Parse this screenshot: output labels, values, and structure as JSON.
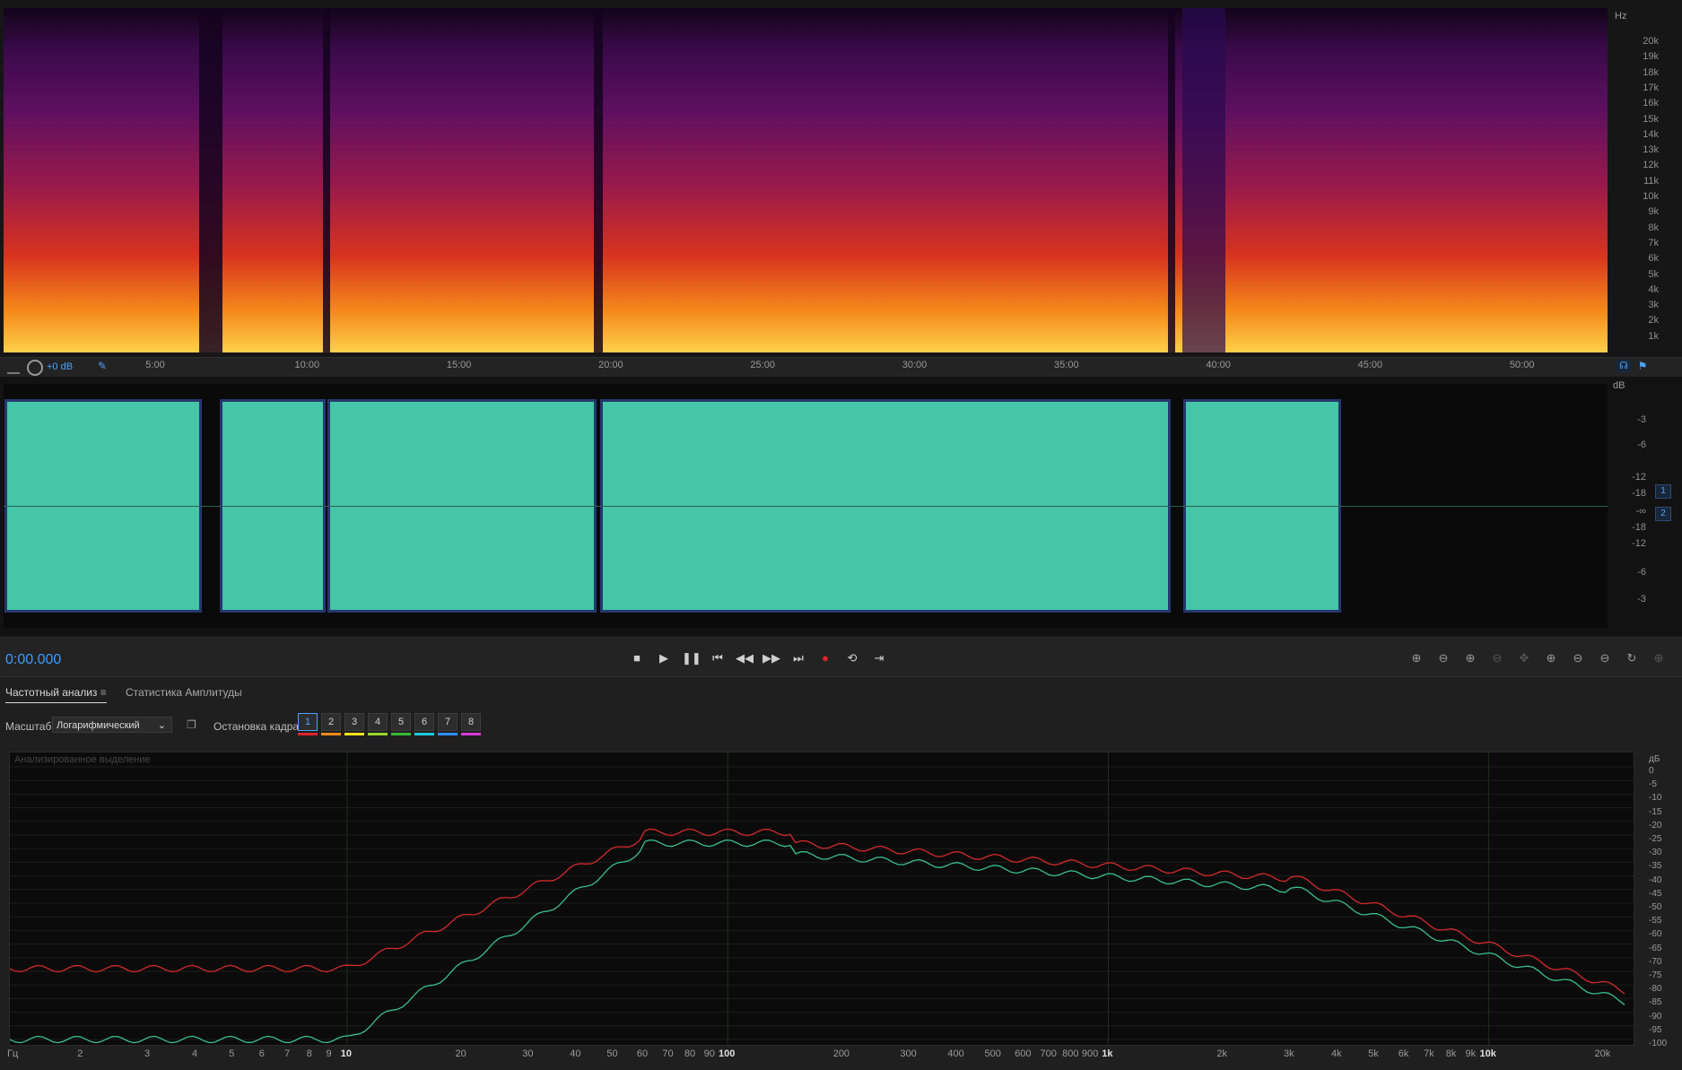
{
  "spectrogram": {
    "unit": "Hz",
    "freq_labels": [
      "20k",
      "19k",
      "18k",
      "17k",
      "16k",
      "15k",
      "14k",
      "13k",
      "12k",
      "11k",
      "10k",
      "9k",
      "8k",
      "7k",
      "6k",
      "5k",
      "4k",
      "3k",
      "2k",
      "1k"
    ]
  },
  "ruler": {
    "gain": "+0 dB",
    "times": [
      "5:00",
      "10:00",
      "15:00",
      "20:00",
      "25:00",
      "30:00",
      "35:00",
      "40:00",
      "45:00",
      "50:00"
    ]
  },
  "waveform": {
    "db_unit": "dB",
    "db_labels": [
      "-3",
      "-6",
      "-12",
      "-18",
      "-∞",
      "-18",
      "-12",
      "-6",
      "-3"
    ],
    "channels": [
      "1",
      "2"
    ]
  },
  "transport": {
    "time": "0:00.000",
    "buttons": [
      "stop",
      "play",
      "pause",
      "to-start",
      "rewind",
      "fast-forward",
      "to-end",
      "record",
      "loop",
      "skip"
    ]
  },
  "analysis": {
    "tabs": [
      "Частотный анализ",
      "Статистика Амплитуды"
    ],
    "scale_label": "Масштаб:",
    "scale_value": "Логарифмический",
    "freeze_label": "Остановка кадра:",
    "frames": [
      "1",
      "2",
      "3",
      "4",
      "5",
      "6",
      "7",
      "8"
    ],
    "frame_colors": [
      "#e0262b",
      "#f08a1c",
      "#f2e21d",
      "#9ad52d",
      "#36b83a",
      "#1fc8d6",
      "#2f8ff0",
      "#d93bd9"
    ],
    "graph_title": "Анализированное выделение",
    "x_unit": "Гц",
    "x_labels": [
      "2",
      "3",
      "4",
      "5",
      "6",
      "7",
      "8",
      "9",
      "10",
      "20",
      "30",
      "40",
      "50",
      "60",
      "70",
      "80",
      "90",
      "100",
      "200",
      "300",
      "400",
      "500",
      "600",
      "700",
      "800",
      "900",
      "1k",
      "2k",
      "3k",
      "4k",
      "5k",
      "6k",
      "7k",
      "8k",
      "9k",
      "10k",
      "20k"
    ],
    "y_unit": "дБ",
    "y_labels": [
      "0",
      "-5",
      "-10",
      "-15",
      "-20",
      "-25",
      "-30",
      "-35",
      "-40",
      "-45",
      "-50",
      "-55",
      "-60",
      "-65",
      "-70",
      "-75",
      "-80",
      "-85",
      "-90",
      "-95",
      "-100"
    ],
    "series_colors": [
      "#d42a2a",
      "#3bbf8c"
    ]
  }
}
